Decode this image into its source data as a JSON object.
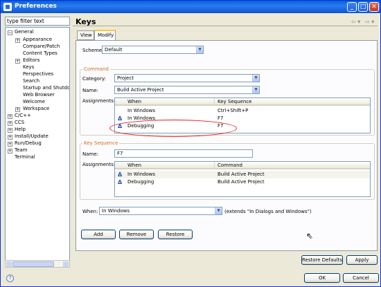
{
  "window": {
    "title": "Preferences"
  },
  "filter": {
    "placeholder": "type filter text"
  },
  "tree": {
    "general": "General",
    "general_children": [
      "Appearance",
      "Compare/Patch",
      "Content Types",
      "Editors",
      "Keys",
      "Perspectives",
      "Search",
      "Startup and Shutdow",
      "Web Browser",
      "Welcome",
      "Workspace"
    ],
    "top_items": [
      "C/C++",
      "CCS",
      "Help",
      "Install/Update",
      "Run/Debug",
      "Team",
      "Terminal"
    ]
  },
  "page": {
    "title": "Keys"
  },
  "tabs": [
    "View",
    "Modify"
  ],
  "scheme": {
    "label": "Scheme:",
    "value": "Default"
  },
  "command": {
    "group_label": "Command",
    "category_label": "Category:",
    "category_value": "Project",
    "name_label": "Name:",
    "name_value": "Build Active Project",
    "assignments_label": "Assignments:",
    "headers": [
      "When",
      "Key Sequence"
    ],
    "rows": [
      {
        "when": "In Windows",
        "key": "Ctrl+Shift+P",
        "icon": false
      },
      {
        "when": "In Windows",
        "key": "F7",
        "icon": true
      },
      {
        "when": "Debugging",
        "key": "F7",
        "icon": true
      }
    ]
  },
  "key_sequence": {
    "group_label": "Key Sequence",
    "name_label": "Name:",
    "name_value": "F7",
    "assignments_label": "Assignments:",
    "headers": [
      "When",
      "Command"
    ],
    "rows": [
      {
        "when": "In Windows",
        "command": "Build Active Project"
      },
      {
        "when": "Debugging",
        "command": "Build Active Project"
      }
    ]
  },
  "when": {
    "label": "When:",
    "value": "In Windows",
    "note": "(extends \"In Dialogs and Windows\")"
  },
  "buttons": {
    "add": "Add",
    "remove": "Remove",
    "restore": "Restore",
    "restore_defaults": "Restore Defaults",
    "apply": "Apply",
    "ok": "OK",
    "cancel": "Cancel"
  },
  "colors": {
    "titlebar": "#0a5fd8",
    "group_title": "#d46a1e",
    "highlight_ellipse": "#e02020"
  }
}
